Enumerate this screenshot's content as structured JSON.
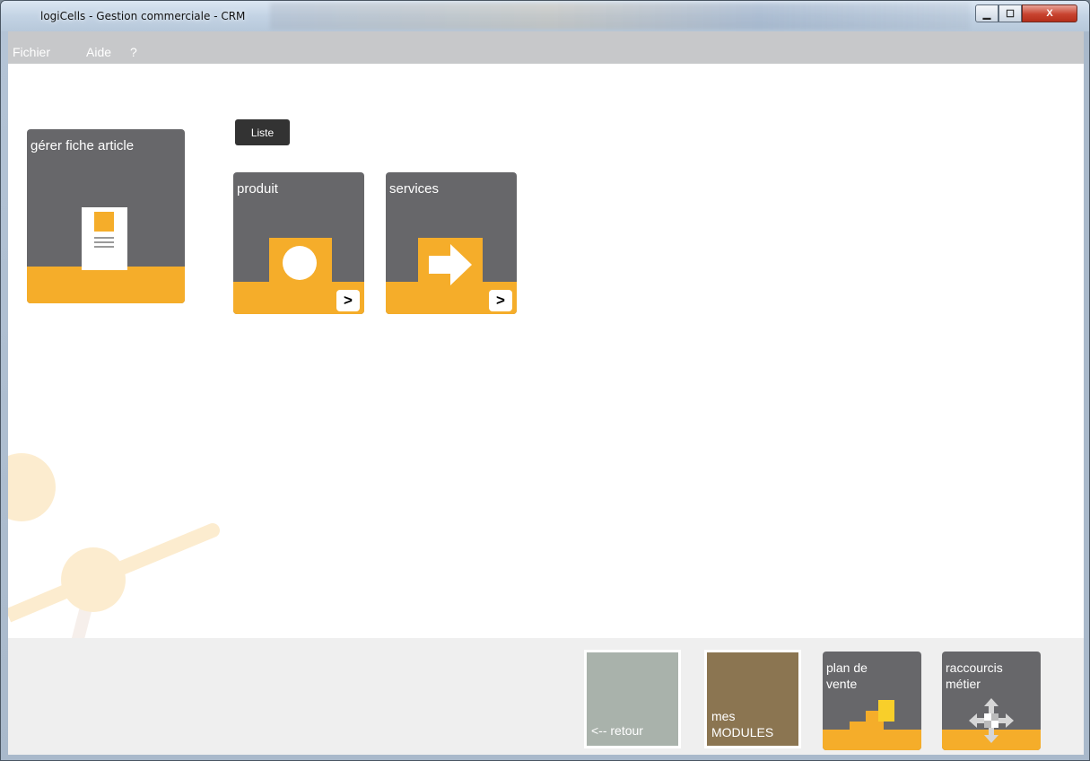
{
  "window": {
    "title": "logiCells - Gestion commerciale - CRM",
    "controls": {
      "minimize": "▁",
      "maximize": "☐",
      "close": "X"
    }
  },
  "menu": {
    "items": [
      "Fichier",
      "Aide",
      "?"
    ]
  },
  "main": {
    "gerer_tile": {
      "label": "gérer fiche article",
      "icon": "document-icon"
    },
    "liste_button": "Liste",
    "tiles": [
      {
        "label": "produit",
        "icon": "circle-box-icon",
        "go": ">"
      },
      {
        "label": "services",
        "icon": "arrow-box-icon",
        "go": ">"
      }
    ]
  },
  "footer": {
    "retour": "<-- retour",
    "modules": {
      "line1": "mes",
      "line2": "MODULES"
    },
    "plan_vente": {
      "line1": "plan de",
      "line2": "vente",
      "icon": "stairs-icon"
    },
    "raccourcis": {
      "line1": "raccourcis",
      "line2": "métier",
      "icon": "move-arrows-icon"
    }
  },
  "colors": {
    "tile_gray": "#67676a",
    "accent_orange": "#f5ad2a",
    "retour_green": "#a9b2ab",
    "modules_brown": "#8b7551",
    "menubar": "#c7c8ca",
    "footer_bg": "#efefef"
  }
}
